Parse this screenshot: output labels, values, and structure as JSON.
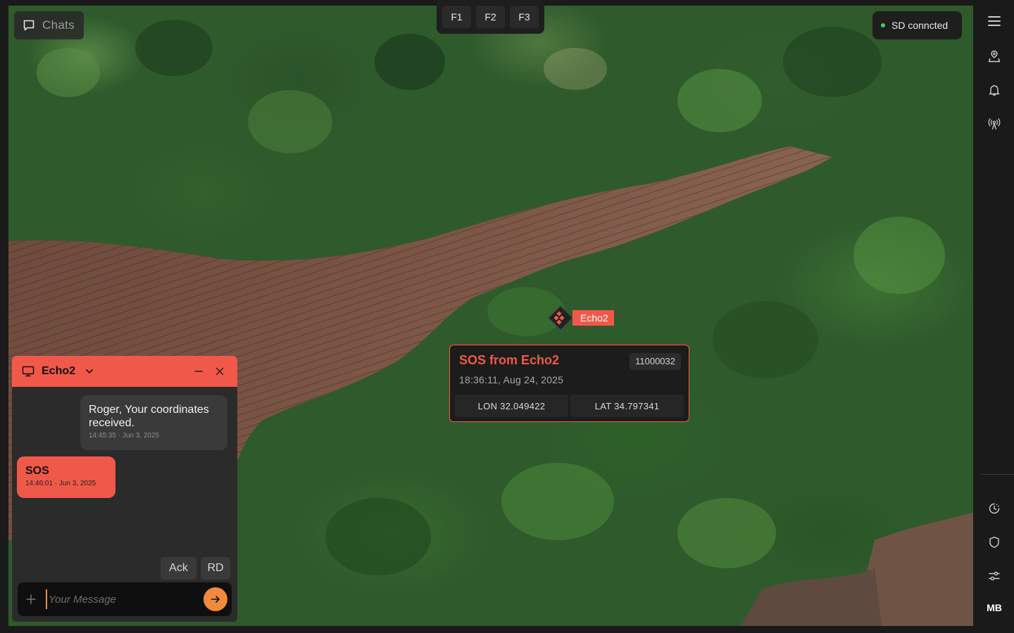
{
  "chats_button": {
    "label": "Chats",
    "icon": "chat-bubble-icon"
  },
  "ftabs": [
    "F1",
    "F2",
    "F3"
  ],
  "status": {
    "label": "SD conncted",
    "color": "#3fcf52"
  },
  "sidebar": {
    "top_icons": [
      "menu-icon",
      "map-pin-icon",
      "bell-icon",
      "antenna-icon"
    ],
    "bottom_icons": [
      "clock-history-icon",
      "shield-icon",
      "sliders-icon"
    ],
    "user_initials": "MB"
  },
  "marker": {
    "label": "Echo2",
    "color": "#f0594a"
  },
  "sos_popup": {
    "title": "SOS from Echo2",
    "id": "11000032",
    "timestamp": "18:36:11, Aug 24, 2025",
    "lon": "LON 32.049422",
    "lat": "LAT 34.797341"
  },
  "chat": {
    "contact": "Echo2",
    "messages": [
      {
        "direction": "incoming",
        "text": "Roger, Your coordinates received.",
        "meta": "14:45:35 · Jun 3, 2025"
      },
      {
        "direction": "outgoing",
        "text": "SOS",
        "meta": "14:46:01 · Jun 3, 2025"
      }
    ],
    "quick_replies": [
      "Ack",
      "RD"
    ],
    "input_placeholder": "Your Message",
    "input_value": ""
  },
  "colors": {
    "accent": "#f0594a",
    "send": "#f28a3d",
    "panel": "#2b2b2b"
  }
}
